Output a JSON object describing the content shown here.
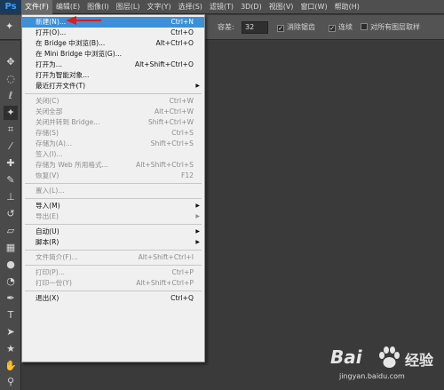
{
  "app": {
    "logo": "Ps"
  },
  "menubar": [
    {
      "label": "文件(F)",
      "active": true
    },
    {
      "label": "编辑(E)"
    },
    {
      "label": "图像(I)"
    },
    {
      "label": "图层(L)"
    },
    {
      "label": "文字(Y)"
    },
    {
      "label": "选择(S)"
    },
    {
      "label": "滤镜(T)"
    },
    {
      "label": "3D(D)"
    },
    {
      "label": "视图(V)"
    },
    {
      "label": "窗口(W)"
    },
    {
      "label": "帮助(H)"
    }
  ],
  "options": {
    "tolerance_label": "容差:",
    "tolerance_value": "32",
    "anti_alias": "消除锯齿",
    "contiguous": "连续",
    "sample_all_layers": "对所有图层取样"
  },
  "file_menu": [
    {
      "label": "新建(N)...",
      "shortcut": "Ctrl+N",
      "state": "highlight"
    },
    {
      "label": "打开(O)...",
      "shortcut": "Ctrl+O"
    },
    {
      "label": "在 Bridge 中浏览(B)...",
      "shortcut": "Alt+Ctrl+O"
    },
    {
      "label": "在 Mini Bridge 中浏览(G)..."
    },
    {
      "label": "打开为...",
      "shortcut": "Alt+Shift+Ctrl+O"
    },
    {
      "label": "打开为智能对象..."
    },
    {
      "label": "最近打开文件(T)",
      "submenu": true
    },
    {
      "separator": true
    },
    {
      "label": "关闭(C)",
      "shortcut": "Ctrl+W",
      "state": "disabled"
    },
    {
      "label": "关闭全部",
      "shortcut": "Alt+Ctrl+W",
      "state": "disabled"
    },
    {
      "label": "关闭并转到 Bridge...",
      "shortcut": "Shift+Ctrl+W",
      "state": "disabled"
    },
    {
      "label": "存储(S)",
      "shortcut": "Ctrl+S",
      "state": "disabled"
    },
    {
      "label": "存储为(A)...",
      "shortcut": "Shift+Ctrl+S",
      "state": "disabled"
    },
    {
      "label": "签入(I)...",
      "state": "disabled"
    },
    {
      "label": "存储为 Web 所用格式...",
      "shortcut": "Alt+Shift+Ctrl+S",
      "state": "disabled"
    },
    {
      "label": "恢复(V)",
      "shortcut": "F12",
      "state": "disabled"
    },
    {
      "separator": true
    },
    {
      "label": "置入(L)...",
      "state": "disabled"
    },
    {
      "separator": true
    },
    {
      "label": "导入(M)",
      "submenu": true
    },
    {
      "label": "导出(E)",
      "submenu": true,
      "state": "disabled"
    },
    {
      "separator": true
    },
    {
      "label": "自动(U)",
      "submenu": true
    },
    {
      "label": "脚本(R)",
      "submenu": true
    },
    {
      "separator": true
    },
    {
      "label": "文件简介(F)...",
      "shortcut": "Alt+Shift+Ctrl+I",
      "state": "disabled"
    },
    {
      "separator": true
    },
    {
      "label": "打印(P)...",
      "shortcut": "Ctrl+P",
      "state": "disabled"
    },
    {
      "label": "打印一份(Y)",
      "shortcut": "Alt+Shift+Ctrl+P",
      "state": "disabled"
    },
    {
      "separator": true
    },
    {
      "label": "退出(X)",
      "shortcut": "Ctrl+Q"
    }
  ],
  "watermark": {
    "brand": "Bai",
    "brand2": "经验",
    "url": "jingyan.baidu.com"
  }
}
